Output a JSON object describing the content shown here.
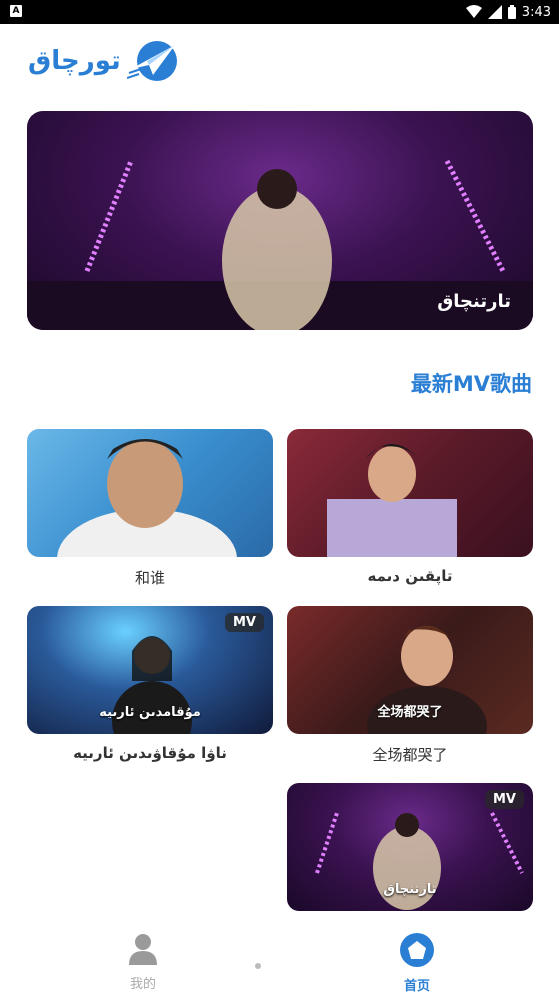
{
  "status_bar": {
    "notification_icon": "A",
    "time": "3:43",
    "icons": [
      "wifi-icon",
      "signal-icon",
      "battery-icon"
    ]
  },
  "header": {
    "logo_text": "تورچاق",
    "logo_icon": "paper-plane-logo-icon"
  },
  "banner": {
    "caption": "تارتنچاق"
  },
  "section": {
    "title": "最新MV歌曲"
  },
  "videos": [
    {
      "title": "和谁",
      "badge": "",
      "overlay": ""
    },
    {
      "title": "تاپقىن دىمە",
      "badge": "",
      "overlay": ""
    },
    {
      "title": "ناۋا مۇقاۋىدىن ئارىيە",
      "badge": "MV",
      "overlay": "مۇقامدىن ئارىيە"
    },
    {
      "title": "全场都哭了",
      "badge": "",
      "overlay": "全场都哭了"
    },
    {
      "title": "",
      "badge": "MV",
      "overlay": "تارتنچاق"
    }
  ],
  "bottom_nav": {
    "me_label": "我的",
    "home_label": "首页"
  },
  "colors": {
    "accent": "#2a7fd4",
    "inactive": "#aaaaaa"
  }
}
